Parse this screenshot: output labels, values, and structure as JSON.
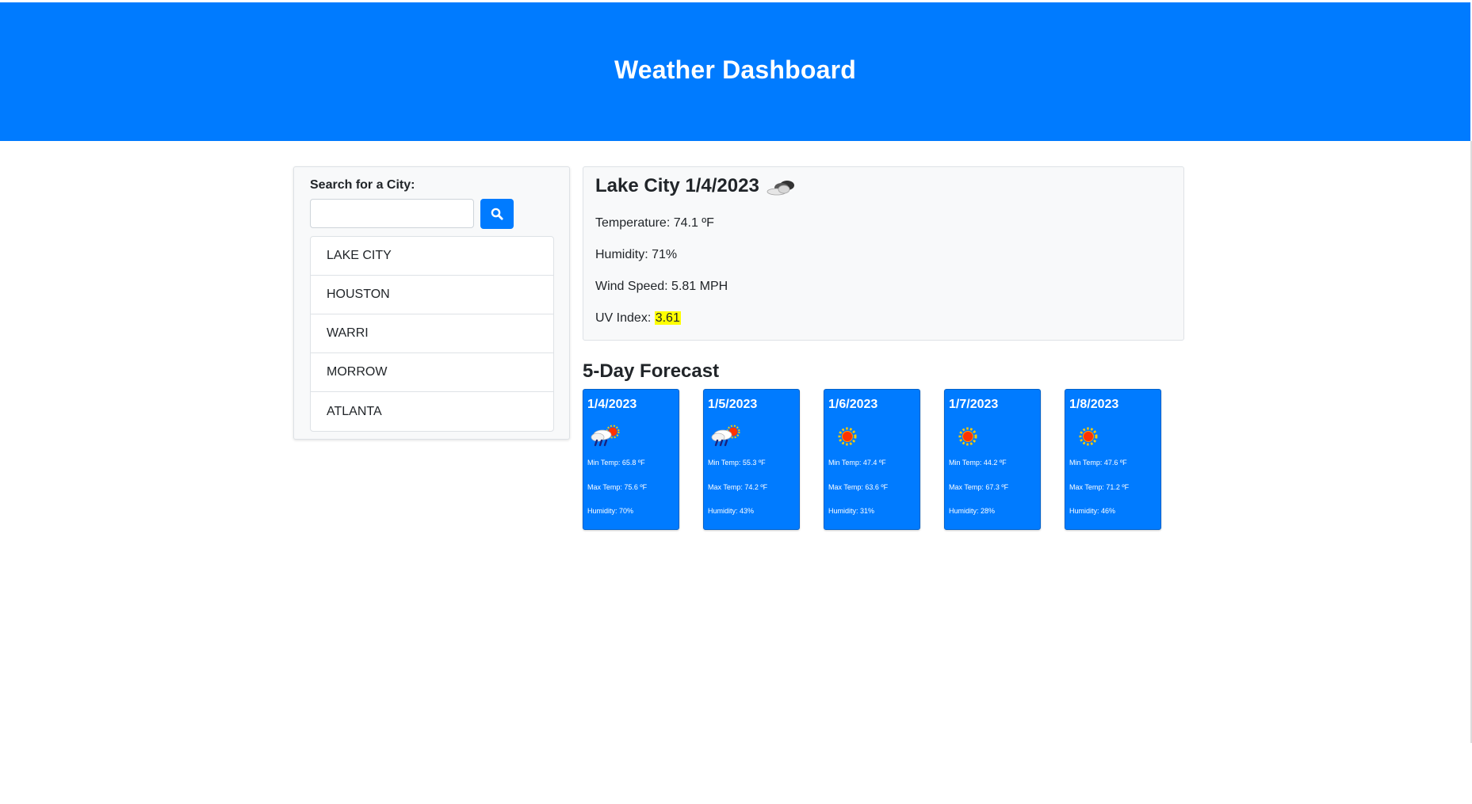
{
  "header": {
    "title": "Weather Dashboard"
  },
  "search": {
    "label": "Search for a City:",
    "input_value": "",
    "button_icon": "search-icon"
  },
  "history": [
    "LAKE CITY",
    "HOUSTON",
    "WARRI",
    "MORROW",
    "ATLANTA"
  ],
  "current": {
    "title": "Lake City 1/4/2023",
    "icon": "cloudy-icon",
    "temperature": "Temperature: 74.1 ºF",
    "humidity": "Humidity: 71%",
    "wind": "Wind Speed: 5.81 MPH",
    "uv_label": "UV Index: ",
    "uv_value": "3.61",
    "uv_color": "#ffff00"
  },
  "forecast": {
    "heading": "5-Day Forecast",
    "days": [
      {
        "date": "1/4/2023",
        "icon": "rain-sun-icon",
        "min": "Min Temp: 65.8 ºF",
        "max": "Max Temp: 75.6 ºF",
        "humidity": "Humidity: 70%"
      },
      {
        "date": "1/5/2023",
        "icon": "rain-sun-icon",
        "min": "Min Temp: 55.3 ºF",
        "max": "Max Temp: 74.2 ºF",
        "humidity": "Humidity: 43%"
      },
      {
        "date": "1/6/2023",
        "icon": "sun-icon",
        "min": "Min Temp: 47.4 ºF",
        "max": "Max Temp: 63.6 ºF",
        "humidity": "Humidity: 31%"
      },
      {
        "date": "1/7/2023",
        "icon": "sun-icon",
        "min": "Min Temp: 44.2 ºF",
        "max": "Max Temp: 67.3 ºF",
        "humidity": "Humidity: 28%"
      },
      {
        "date": "1/8/2023",
        "icon": "sun-icon",
        "min": "Min Temp: 47.6 ºF",
        "max": "Max Temp: 71.2 ºF",
        "humidity": "Humidity: 46%"
      }
    ]
  },
  "colors": {
    "primary": "#007bff",
    "panel": "#f8f9fa",
    "border": "#dee2e6"
  }
}
